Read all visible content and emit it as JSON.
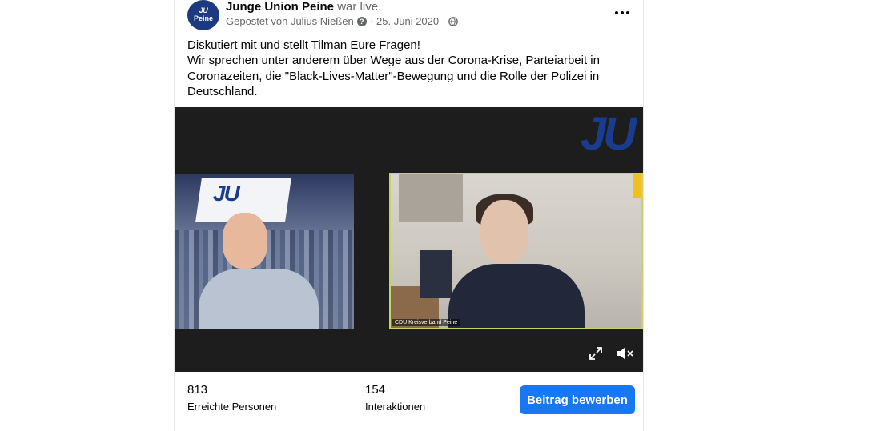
{
  "post": {
    "avatar": {
      "line1": "JU",
      "line2": "Peine"
    },
    "page_name": "Junge Union Peine",
    "status": "war live.",
    "meta": {
      "posted_by": "Gepostet von Julius Nießen",
      "date": "25. Juni 2020",
      "separator": "·"
    },
    "text_lines": [
      "Diskutiert mit und stellt Tilman Eure Fragen!",
      "Wir sprechen unter anderem über Wege aus der Corona-Krise, Parteiarbeit in",
      "Coronazeiten, die \"Black-Lives-Matter\"-Bewegung und die Rolle der Polizei in",
      "Deutschland."
    ]
  },
  "video": {
    "logo": "JU",
    "left_banner": "JU",
    "right_tile_label": "CDU Kreisverband Peine",
    "icons": {
      "fullscreen": "fullscreen-icon",
      "mute": "mute-icon"
    }
  },
  "stats": {
    "reach": {
      "value": "813",
      "label": "Erreichte Personen"
    },
    "interactions": {
      "value": "154",
      "label": "Interaktionen"
    }
  },
  "actions": {
    "promote": "Beitrag bewerben"
  },
  "colors": {
    "accent": "#1877f2",
    "brand": "#1a3c8f",
    "meta_text": "#65676b"
  }
}
